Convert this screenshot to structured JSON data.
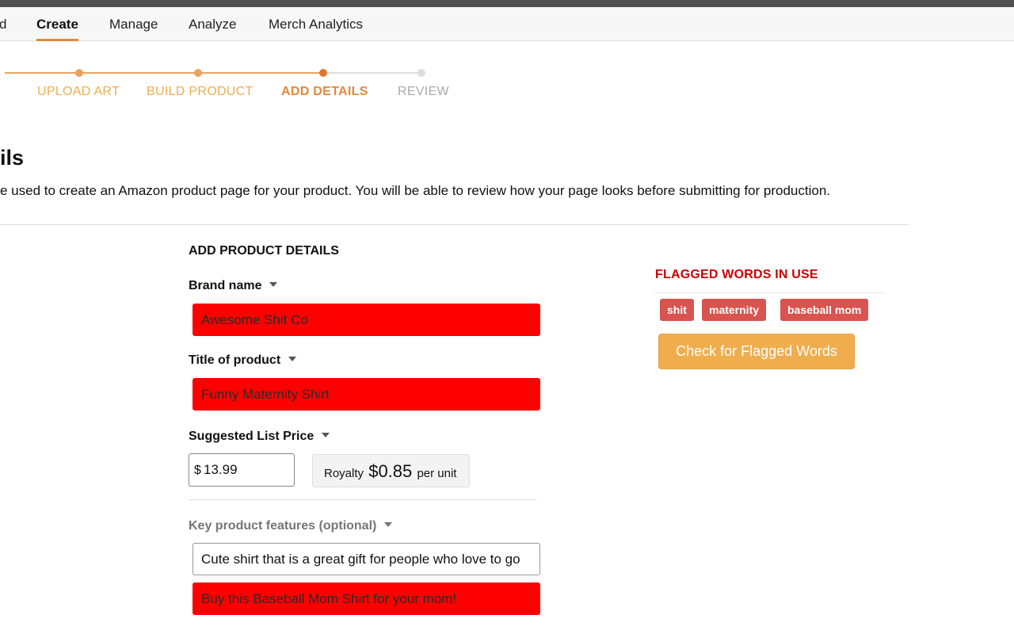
{
  "nav": {
    "items": [
      {
        "label": "d"
      },
      {
        "label": "Create"
      },
      {
        "label": "Manage"
      },
      {
        "label": "Analyze"
      },
      {
        "label": "Merch Analytics"
      }
    ]
  },
  "stepper": {
    "steps": [
      {
        "label": "UPLOAD ART"
      },
      {
        "label": "BUILD PRODUCT"
      },
      {
        "label": "ADD DETAILS"
      },
      {
        "label": "REVIEW"
      }
    ]
  },
  "page": {
    "heading": "ils",
    "intro": "e used to create an Amazon product page for your product. You will be able to review how your page looks before submitting for production."
  },
  "form": {
    "section_title": "ADD PRODUCT DETAILS",
    "brand": {
      "label": "Brand name",
      "value": "Awesome Shit Co"
    },
    "title": {
      "label": "Title of product",
      "value": "Funny Maternity Shirt"
    },
    "price": {
      "label": "Suggested List Price",
      "currency": "$",
      "value": "13.99"
    },
    "royalty": {
      "prefix": "Royalty",
      "amount": "$0.85",
      "suffix": "per unit"
    },
    "features": {
      "label": "Key product features (optional)",
      "bullet1": "Cute shirt that is a great gift for people who love to go",
      "bullet2": "Buy this Baseball Mom Shirt for your mom!"
    }
  },
  "flagged": {
    "title": "FLAGGED WORDS IN USE",
    "tags": [
      "shit",
      "maternity",
      "baseball mom"
    ],
    "button_label": "Check for Flagged Words"
  },
  "colors": {
    "accent": "#e3883b",
    "step_done": "#f0ad4e",
    "step_active": "#e3883b",
    "step_pending": "#aaaaaa",
    "flag_field": "#ff0000",
    "flag_tag": "#d9534f",
    "flag_title": "#cc0000",
    "check_button": "#f0ad4e"
  }
}
